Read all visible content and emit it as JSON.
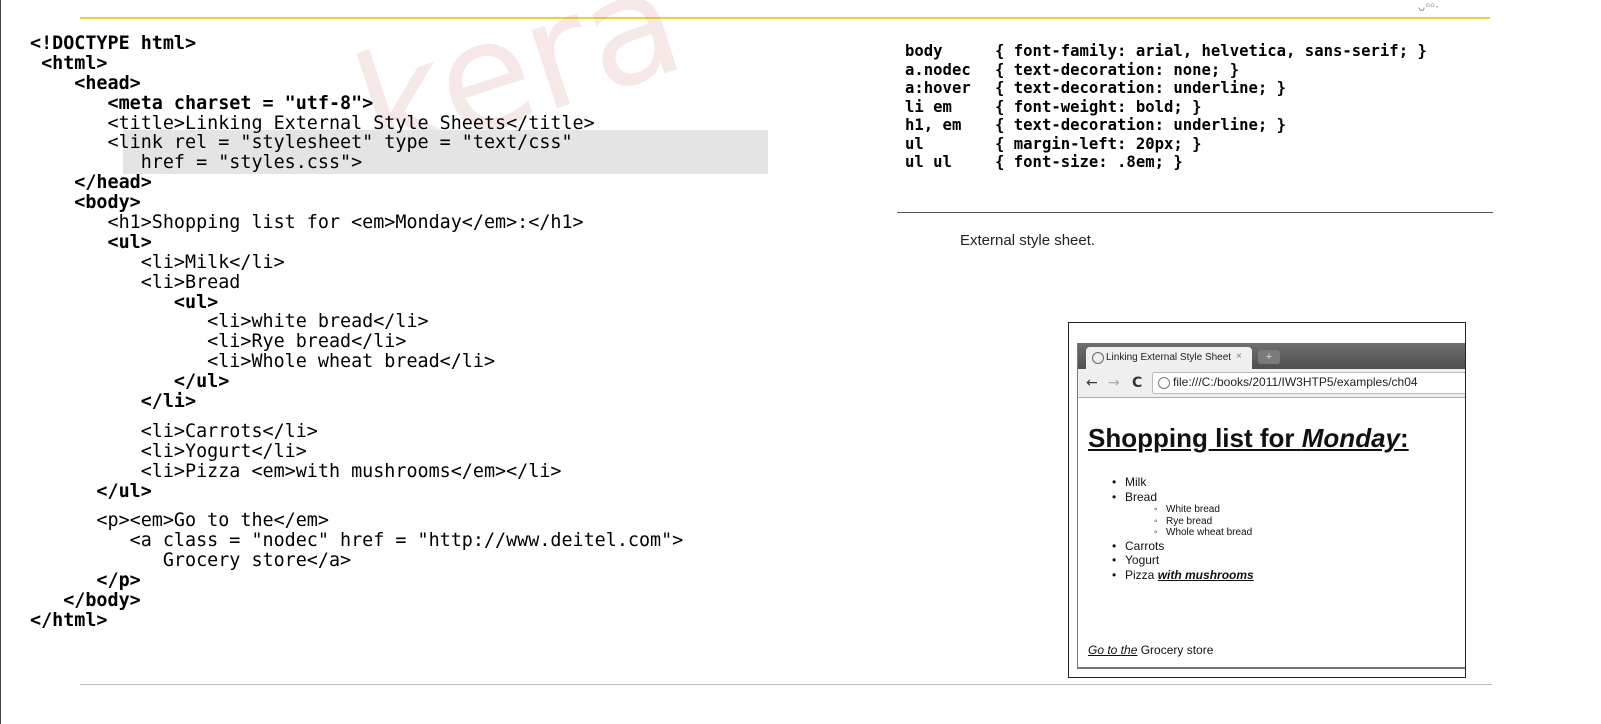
{
  "html_code": {
    "lines": [
      "<!DOCTYPE html>",
      " <html>",
      "    <head>",
      "       <meta charset = \"utf-8\">",
      "       <title>Linking External Style Sheets</title>",
      "       <link rel = \"stylesheet\" type = \"text/css\"",
      "          href = \"styles.css\">",
      "    </head>",
      "    <body>",
      "       <h1>Shopping list for <em>Monday</em>:</h1>",
      "       <ul>",
      "          <li>Milk</li>",
      "          <li>Bread",
      "             <ul>",
      "                <li>white bread</li>",
      "                <li>Rye bread</li>",
      "                <li>Whole wheat bread</li>",
      "             </ul>",
      "          </li>",
      "",
      "          <li>Carrots</li>",
      "          <li>Yogurt</li>",
      "          <li>Pizza <em>with mushrooms</em></li>",
      "      </ul>",
      "",
      "      <p><em>Go to the</em>",
      "         <a class = \"nodec\" href = \"http://www.deitel.com\">",
      "            Grocery store</a>",
      "      </p>",
      "   </body>",
      "</html>"
    ]
  },
  "css_code": {
    "rules": [
      {
        "selector": "body",
        "decl": "{ font-family: arial, helvetica, sans-serif; }"
      },
      {
        "selector": "a.nodec",
        "decl": "{ text-decoration: none; }"
      },
      {
        "selector": "a:hover",
        "decl": "{ text-decoration: underline; }"
      },
      {
        "selector": "li em",
        "decl": "{ font-weight: bold; }"
      },
      {
        "selector": "h1, em",
        "decl": "{ text-decoration: underline; }"
      },
      {
        "selector": "ul",
        "decl": "{ margin-left: 20px; }"
      },
      {
        "selector": "ul ul",
        "decl": "{ font-size: .8em; }"
      }
    ]
  },
  "caption": "External style sheet.",
  "browser": {
    "tab_title": "Linking External Style Sheet",
    "tab_close": "×",
    "new_tab": "+",
    "back_icon": "←",
    "forward_icon": "→",
    "reload_icon": "C",
    "url": "file:///C:/books/2011/IW3HTP5/examples/ch04",
    "page": {
      "heading_text": "Shopping list for ",
      "heading_em": "Monday",
      "heading_colon": ":",
      "items": [
        "Milk",
        "Bread"
      ],
      "sub_items": [
        "White bread",
        "Rye bread",
        "Whole wheat bread"
      ],
      "items_after": [
        "Carrots",
        "Yogurt"
      ],
      "pizza_text": "Pizza ",
      "pizza_em": "with mushrooms",
      "p_em": "Go to the",
      "p_link": "Grocery store"
    }
  },
  "watermark_text": "kera",
  "corner_mark": "ᴗᵒᵒ·"
}
